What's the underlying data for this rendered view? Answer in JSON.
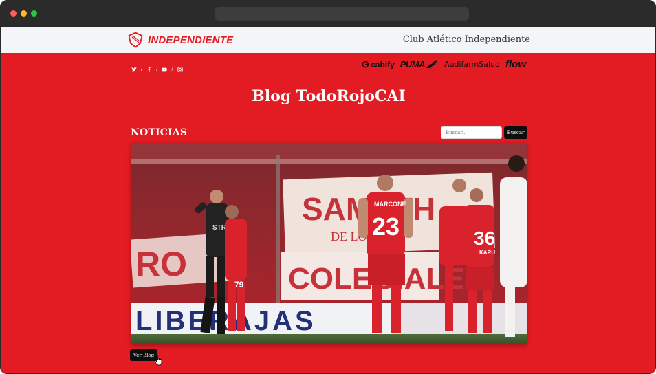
{
  "window": {
    "url": ""
  },
  "header": {
    "logo_text": "INDEPENDIENTE",
    "logo_icon": "club-crest-icon",
    "club_name": "Club Atlético Independiente"
  },
  "social": {
    "icons": [
      "twitter-icon",
      "facebook-icon",
      "youtube-icon",
      "instagram-icon"
    ],
    "separator": "/"
  },
  "sponsors": {
    "cabify": "cabify",
    "puma": "PUMA",
    "audifarm": "AudifarmSalud",
    "flow": "flow"
  },
  "blog": {
    "title": "Blog TodoRojoCAI"
  },
  "news": {
    "section_label": "NOTICIAS",
    "search_placeholder": "Buscar...",
    "search_button": "Buscar",
    "hero_image": {
      "sign_texts": [
        "SAMETH",
        "DE LOMAS",
        "COLEGIALES",
        "RO",
        "LIBERAJAS"
      ],
      "player_names": [
        "MARCONE",
        "KARU",
        "STRAMA"
      ],
      "player_numbers": [
        "23",
        "36",
        "79"
      ]
    },
    "ver_blog_button": "Ver Blog"
  },
  "colors": {
    "primary_red": "#e31b23",
    "topbar": "#f4f5f7",
    "button_dark": "#0d0d0d",
    "chrome": "#2b2b2b"
  }
}
